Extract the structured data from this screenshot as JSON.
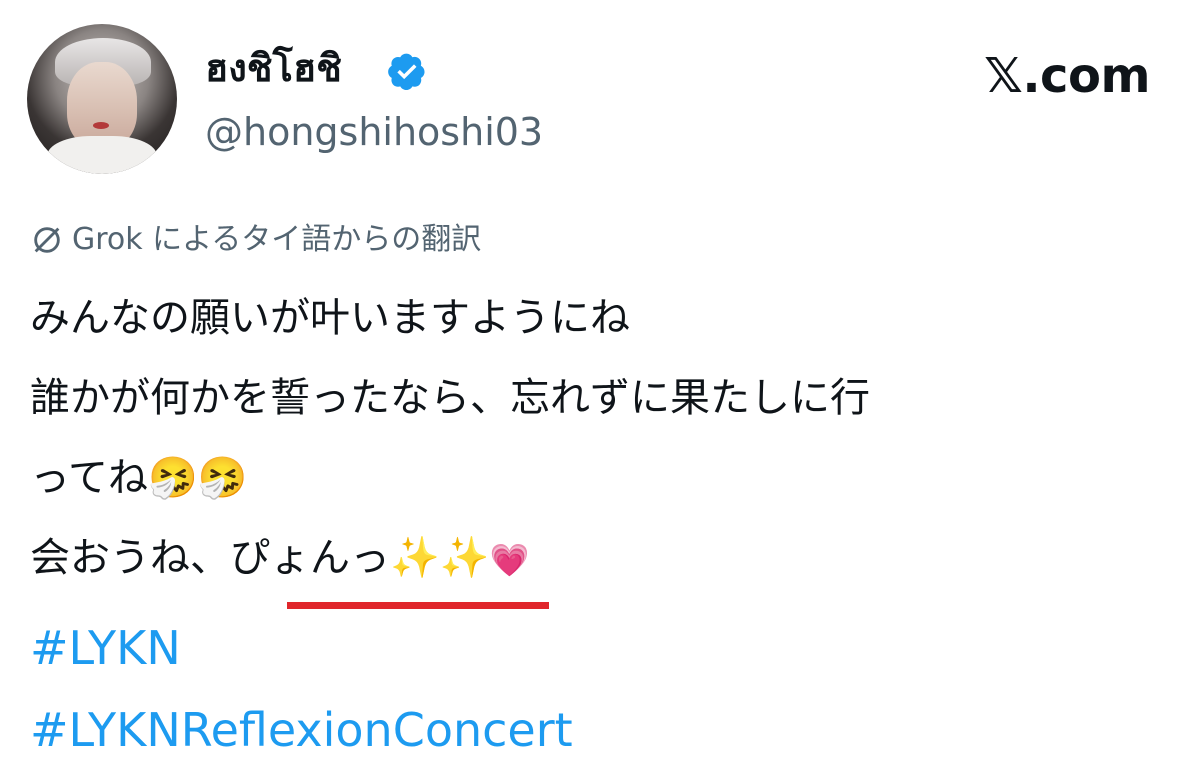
{
  "header": {
    "display_name": "ฮงชิโฮชิ",
    "handle": "@hongshihoshi03",
    "site_logo": "𝕏.com",
    "verified_icon": "verified-badge-icon",
    "avatar": "avatar"
  },
  "translation": {
    "icon": "grok-icon",
    "label": "Grok によるタイ語からの翻訳"
  },
  "tweet": {
    "line1": "みんなの願いが叶いますようにね",
    "line2": "誰かが何かを誓ったなら、忘れずに果たしに行",
    "line3_text": "ってね",
    "line3_emoji": "🤧🤧",
    "line4_prefix": "会おうね、",
    "line4_highlight": "ぴょんっ",
    "line4_sparkles": "✨✨",
    "line4_heart": "💗"
  },
  "hashtags": [
    "#LYKN",
    "#LYKNReflexionConcert"
  ],
  "colors": {
    "hashtag": "#1d9bf0",
    "verified": "#1d9bf0",
    "secondary_text": "#536471",
    "underline": "#e0262b"
  }
}
